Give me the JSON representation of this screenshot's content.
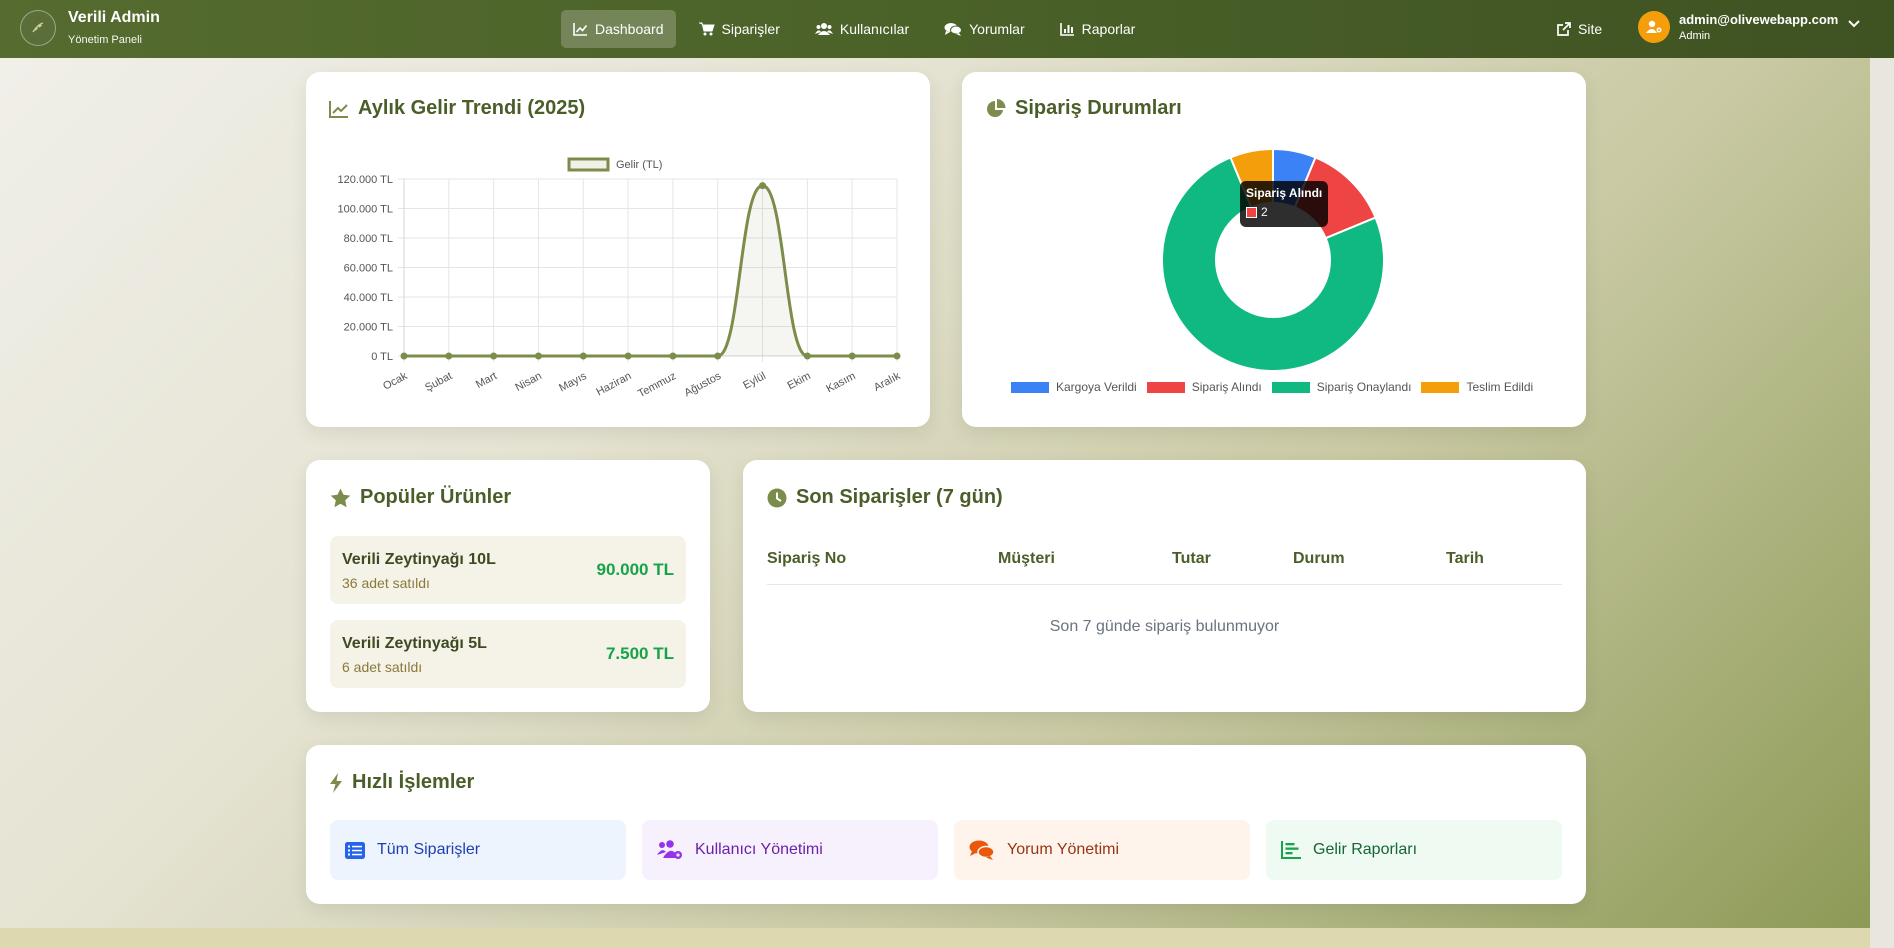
{
  "navbar": {
    "brand_title": "Verili Admin",
    "brand_subtitle": "Yönetim Paneli",
    "menu": [
      {
        "label": "Dashboard",
        "icon": "chart-line-icon",
        "active": true
      },
      {
        "label": "Siparişler",
        "icon": "cart-icon",
        "active": false
      },
      {
        "label": "Kullanıcılar",
        "icon": "users-icon",
        "active": false
      },
      {
        "label": "Yorumlar",
        "icon": "comments-icon",
        "active": false
      },
      {
        "label": "Raporlar",
        "icon": "chart-bar-icon",
        "active": false
      }
    ],
    "site_label": "Site",
    "user_email": "admin@olivewebapp.com",
    "user_role": "Admin"
  },
  "revenue_card": {
    "title": "Aylık Gelir Trendi (2025)"
  },
  "status_card": {
    "title": "Sipariş Durumları",
    "tooltip": {
      "title": "Sipariş Alındı",
      "value": "2"
    }
  },
  "chart_data": [
    {
      "type": "line",
      "title": "Aylık Gelir Trendi (2025)",
      "x": [
        "Ocak",
        "Şubat",
        "Mart",
        "Nisan",
        "Mayıs",
        "Haziran",
        "Temmuz",
        "Ağustos",
        "Eylül",
        "Ekim",
        "Kasım",
        "Aralık"
      ],
      "series": [
        {
          "name": "Gelir (TL)",
          "values": [
            0,
            0,
            0,
            0,
            0,
            0,
            0,
            0,
            115500,
            0,
            0,
            0
          ]
        }
      ],
      "ylim": [
        0,
        120000
      ],
      "yticks": [
        0,
        20000,
        40000,
        60000,
        80000,
        100000,
        120000
      ],
      "ytick_labels": [
        "0 TL",
        "20.000 TL",
        "40.000 TL",
        "60.000 TL",
        "80.000 TL",
        "100.000 TL",
        "120.000 TL"
      ],
      "grid": true,
      "legend": "top",
      "color": "#7c8c4a"
    },
    {
      "type": "pie",
      "title": "Sipariş Durumları",
      "categories": [
        "Kargoya Verildi",
        "Sipariş Alındı",
        "Sipariş Onaylandı",
        "Teslim Edildi"
      ],
      "values": [
        1,
        2,
        12,
        1
      ],
      "colors": [
        "#3b82f6",
        "#ef4444",
        "#10b981",
        "#f59e0b"
      ],
      "legend": "bottom"
    }
  ],
  "popular_card": {
    "title": "Popüler Ürünler",
    "items": [
      {
        "name": "Verili Zeytinyağı 10L",
        "sold": "36 adet satıldı",
        "price": "90.000 TL"
      },
      {
        "name": "Verili Zeytinyağı 5L",
        "sold": "6 adet satıldı",
        "price": "7.500 TL"
      }
    ]
  },
  "recent_card": {
    "title": "Son Siparişler (7 gün)",
    "columns": [
      "Sipariş No",
      "Müşteri",
      "Tutar",
      "Durum",
      "Tarih"
    ],
    "empty_text": "Son 7 günde sipariş bulunmuyor"
  },
  "quick_card": {
    "title": "Hızlı İşlemler",
    "actions": [
      {
        "label": "Tüm Siparişler",
        "icon": "list-icon",
        "bg": "#eef4fe",
        "color": "#1e40af"
      },
      {
        "label": "Kullanıcı Yönetimi",
        "icon": "users-cog-icon",
        "bg": "#f7f1fe",
        "color": "#6b21a8"
      },
      {
        "label": "Yorum Yönetimi",
        "icon": "comments-icon",
        "bg": "#fef4ec",
        "color": "#9a3412"
      },
      {
        "label": "Gelir Raporları",
        "icon": "chart-bar-icon",
        "bg": "#eefaf2",
        "color": "#166534"
      }
    ]
  }
}
